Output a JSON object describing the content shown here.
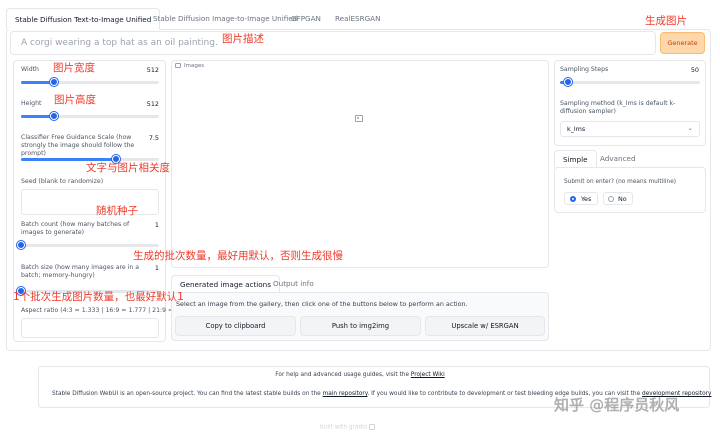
{
  "tabs": [
    {
      "label": "Stable Diffusion Text-to-Image Unified",
      "active": true
    },
    {
      "label": "Stable Diffusion Image-to-Image Unified",
      "active": false
    },
    {
      "label": "GFPGAN",
      "active": false
    },
    {
      "label": "RealESRGAN",
      "active": false
    }
  ],
  "prompt": {
    "placeholder": "A corgi wearing a top hat as an oil painting."
  },
  "generate_label": "Generate",
  "settings": {
    "width": {
      "label": "Width",
      "value": "512",
      "fraction": 0.24
    },
    "height": {
      "label": "Height",
      "value": "512",
      "fraction": 0.24
    },
    "cfg": {
      "label": "Classifier Free Guidance Scale (how strongly the image should follow the prompt)",
      "value": "7.5",
      "fraction": 0.69
    },
    "seed": {
      "label": "Seed (blank to randomize)"
    },
    "batch_count": {
      "label": "Batch count (how many batches of images to generate)",
      "value": "1",
      "fraction": 0.0
    },
    "batch_size": {
      "label": "Batch size (how many images are in a batch; memory-hungry)",
      "value": "1",
      "fraction": 0.0
    },
    "aspect": {
      "label": "Aspect ratio (4:3 = 1.333 | 16:9 = 1.777 | 21:9 = 2.333)"
    }
  },
  "images_label": "Images",
  "output_tabs": [
    "Generated image actions",
    "Output info"
  ],
  "output_hint": "Select an image from the gallery, then click one of the buttons below to perform an action.",
  "actions": [
    "Copy to clipboard",
    "Push to img2img",
    "Upscale w/ ESRGAN"
  ],
  "right": {
    "steps_label": "Sampling Steps",
    "steps_value": "50",
    "steps_fraction": 0.06,
    "method_label": "Sampling method (k_lms is default k-diffusion sampler)",
    "method_value": "k_lms",
    "mode_tabs": [
      "Simple",
      "Advanced"
    ],
    "submit_label": "Submit on enter? (no means multiline)",
    "yes": "Yes",
    "no": "No"
  },
  "footer": {
    "help": "For help and advanced usage guides, visit the",
    "help_link": "Project Wiki",
    "line2a": "Stable Diffusion WebUI is an open-source project. You can find the latest stable builds on the",
    "line2_link": "main repository",
    "line2b": ". If you would like to contribute to development or test bleeding edge builds, you can visit the",
    "line2_link2": "development repository",
    "built": "built with gradio"
  },
  "annotations": {
    "generate": "生成图片",
    "prompt": "图片描述",
    "width": "图片宽度",
    "height": "图片高度",
    "cfg": "文字与图片相关度",
    "seed": "随机种子",
    "batch_count": "生成的批次数量，最好用默认，否则生成很慢",
    "batch_size": "1个批次生成图片数量，也最好默认1"
  },
  "watermark": "知乎 @程序员秋风"
}
